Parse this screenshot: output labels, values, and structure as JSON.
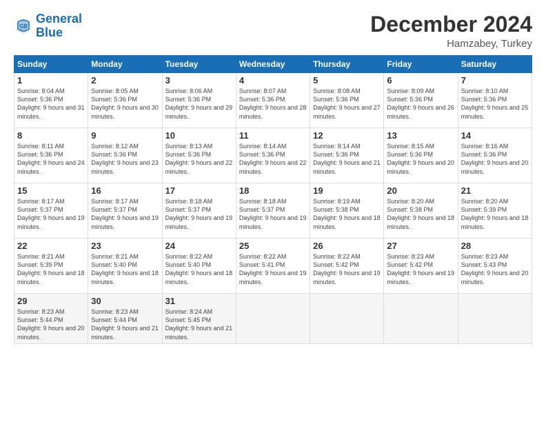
{
  "logo": {
    "line1": "General",
    "line2": "Blue"
  },
  "title": "December 2024",
  "subtitle": "Hamzabey, Turkey",
  "days_of_week": [
    "Sunday",
    "Monday",
    "Tuesday",
    "Wednesday",
    "Thursday",
    "Friday",
    "Saturday"
  ],
  "weeks": [
    [
      {
        "day": "1",
        "sunrise": "Sunrise: 8:04 AM",
        "sunset": "Sunset: 5:36 PM",
        "daylight": "Daylight: 9 hours and 31 minutes."
      },
      {
        "day": "2",
        "sunrise": "Sunrise: 8:05 AM",
        "sunset": "Sunset: 5:36 PM",
        "daylight": "Daylight: 9 hours and 30 minutes."
      },
      {
        "day": "3",
        "sunrise": "Sunrise: 8:06 AM",
        "sunset": "Sunset: 5:36 PM",
        "daylight": "Daylight: 9 hours and 29 minutes."
      },
      {
        "day": "4",
        "sunrise": "Sunrise: 8:07 AM",
        "sunset": "Sunset: 5:36 PM",
        "daylight": "Daylight: 9 hours and 28 minutes."
      },
      {
        "day": "5",
        "sunrise": "Sunrise: 8:08 AM",
        "sunset": "Sunset: 5:36 PM",
        "daylight": "Daylight: 9 hours and 27 minutes."
      },
      {
        "day": "6",
        "sunrise": "Sunrise: 8:09 AM",
        "sunset": "Sunset: 5:36 PM",
        "daylight": "Daylight: 9 hours and 26 minutes."
      },
      {
        "day": "7",
        "sunrise": "Sunrise: 8:10 AM",
        "sunset": "Sunset: 5:36 PM",
        "daylight": "Daylight: 9 hours and 25 minutes."
      }
    ],
    [
      {
        "day": "8",
        "sunrise": "Sunrise: 8:11 AM",
        "sunset": "Sunset: 5:36 PM",
        "daylight": "Daylight: 9 hours and 24 minutes."
      },
      {
        "day": "9",
        "sunrise": "Sunrise: 8:12 AM",
        "sunset": "Sunset: 5:36 PM",
        "daylight": "Daylight: 9 hours and 23 minutes."
      },
      {
        "day": "10",
        "sunrise": "Sunrise: 8:13 AM",
        "sunset": "Sunset: 5:36 PM",
        "daylight": "Daylight: 9 hours and 22 minutes."
      },
      {
        "day": "11",
        "sunrise": "Sunrise: 8:14 AM",
        "sunset": "Sunset: 5:36 PM",
        "daylight": "Daylight: 9 hours and 22 minutes."
      },
      {
        "day": "12",
        "sunrise": "Sunrise: 8:14 AM",
        "sunset": "Sunset: 5:36 PM",
        "daylight": "Daylight: 9 hours and 21 minutes."
      },
      {
        "day": "13",
        "sunrise": "Sunrise: 8:15 AM",
        "sunset": "Sunset: 5:36 PM",
        "daylight": "Daylight: 9 hours and 20 minutes."
      },
      {
        "day": "14",
        "sunrise": "Sunrise: 8:16 AM",
        "sunset": "Sunset: 5:36 PM",
        "daylight": "Daylight: 9 hours and 20 minutes."
      }
    ],
    [
      {
        "day": "15",
        "sunrise": "Sunrise: 8:17 AM",
        "sunset": "Sunset: 5:37 PM",
        "daylight": "Daylight: 9 hours and 19 minutes."
      },
      {
        "day": "16",
        "sunrise": "Sunrise: 8:17 AM",
        "sunset": "Sunset: 5:37 PM",
        "daylight": "Daylight: 9 hours and 19 minutes."
      },
      {
        "day": "17",
        "sunrise": "Sunrise: 8:18 AM",
        "sunset": "Sunset: 5:37 PM",
        "daylight": "Daylight: 9 hours and 19 minutes."
      },
      {
        "day": "18",
        "sunrise": "Sunrise: 8:18 AM",
        "sunset": "Sunset: 5:37 PM",
        "daylight": "Daylight: 9 hours and 19 minutes."
      },
      {
        "day": "19",
        "sunrise": "Sunrise: 8:19 AM",
        "sunset": "Sunset: 5:38 PM",
        "daylight": "Daylight: 9 hours and 18 minutes."
      },
      {
        "day": "20",
        "sunrise": "Sunrise: 8:20 AM",
        "sunset": "Sunset: 5:38 PM",
        "daylight": "Daylight: 9 hours and 18 minutes."
      },
      {
        "day": "21",
        "sunrise": "Sunrise: 8:20 AM",
        "sunset": "Sunset: 5:39 PM",
        "daylight": "Daylight: 9 hours and 18 minutes."
      }
    ],
    [
      {
        "day": "22",
        "sunrise": "Sunrise: 8:21 AM",
        "sunset": "Sunset: 5:39 PM",
        "daylight": "Daylight: 9 hours and 18 minutes."
      },
      {
        "day": "23",
        "sunrise": "Sunrise: 8:21 AM",
        "sunset": "Sunset: 5:40 PM",
        "daylight": "Daylight: 9 hours and 18 minutes."
      },
      {
        "day": "24",
        "sunrise": "Sunrise: 8:22 AM",
        "sunset": "Sunset: 5:40 PM",
        "daylight": "Daylight: 9 hours and 18 minutes."
      },
      {
        "day": "25",
        "sunrise": "Sunrise: 8:22 AM",
        "sunset": "Sunset: 5:41 PM",
        "daylight": "Daylight: 9 hours and 19 minutes."
      },
      {
        "day": "26",
        "sunrise": "Sunrise: 8:22 AM",
        "sunset": "Sunset: 5:42 PM",
        "daylight": "Daylight: 9 hours and 19 minutes."
      },
      {
        "day": "27",
        "sunrise": "Sunrise: 8:23 AM",
        "sunset": "Sunset: 5:42 PM",
        "daylight": "Daylight: 9 hours and 19 minutes."
      },
      {
        "day": "28",
        "sunrise": "Sunrise: 8:23 AM",
        "sunset": "Sunset: 5:43 PM",
        "daylight": "Daylight: 9 hours and 20 minutes."
      }
    ],
    [
      {
        "day": "29",
        "sunrise": "Sunrise: 8:23 AM",
        "sunset": "Sunset: 5:44 PM",
        "daylight": "Daylight: 9 hours and 20 minutes."
      },
      {
        "day": "30",
        "sunrise": "Sunrise: 8:23 AM",
        "sunset": "Sunset: 5:44 PM",
        "daylight": "Daylight: 9 hours and 21 minutes."
      },
      {
        "day": "31",
        "sunrise": "Sunrise: 8:24 AM",
        "sunset": "Sunset: 5:45 PM",
        "daylight": "Daylight: 9 hours and 21 minutes."
      },
      null,
      null,
      null,
      null
    ]
  ]
}
